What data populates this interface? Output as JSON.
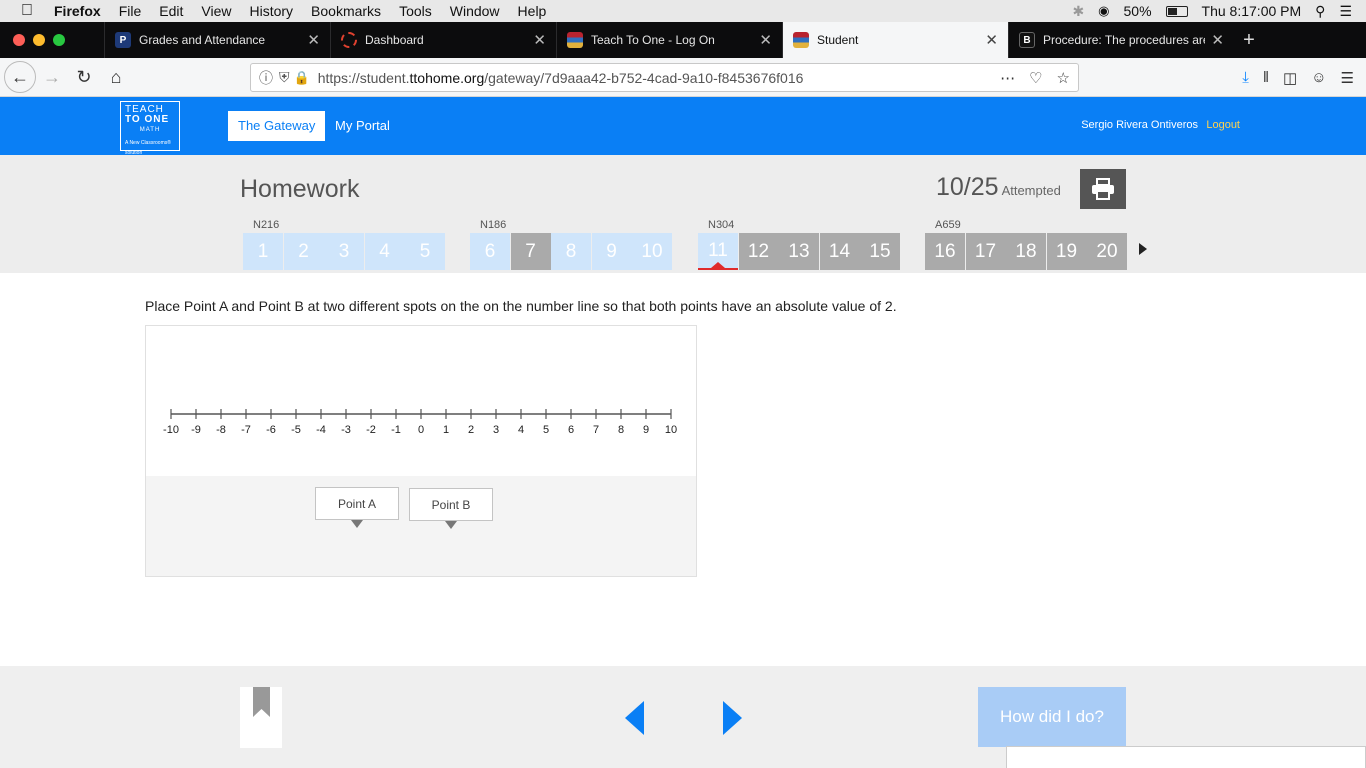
{
  "os_menubar": {
    "app": "Firefox",
    "menus": [
      "File",
      "Edit",
      "View",
      "History",
      "Bookmarks",
      "Tools",
      "Window",
      "Help"
    ],
    "battery": "50%",
    "clock": "Thu 8:17:00 PM"
  },
  "tabs": [
    {
      "label": "Grades and Attendance",
      "favicon": "P",
      "favicon_color": "#1e3a78"
    },
    {
      "label": "Dashboard",
      "favicon": "",
      "favicon_color": "#e0412f"
    },
    {
      "label": "Teach To One - Log On",
      "favicon": "",
      "favicon_color": "#b8232f"
    },
    {
      "label": "Student",
      "favicon": "",
      "favicon_color": "#b8232f",
      "active": true
    },
    {
      "label": "Procedure: The procedures are",
      "favicon": "B",
      "favicon_color": "#111111"
    }
  ],
  "url": {
    "prefix": "https://student.",
    "domain": "ttohome.org",
    "path": "/gateway/7d9aaa42-b752-4cad-9a10-f8453676f016"
  },
  "site": {
    "logo_lines": [
      "TEACH",
      "TO ONE",
      "MATH"
    ],
    "logo_tagline": "A New Classrooms® solution",
    "nav": [
      "The Gateway",
      "My Portal"
    ],
    "user": "Sergio Rivera Ontiveros",
    "logout": "Logout"
  },
  "homework": {
    "title": "Homework",
    "attempted_count": "10/25",
    "attempted_label": "Attempted",
    "groups": [
      {
        "code": "N216",
        "questions": [
          {
            "n": "1",
            "state": "light"
          },
          {
            "n": "2",
            "state": "light"
          },
          {
            "n": "3",
            "state": "light"
          },
          {
            "n": "4",
            "state": "light"
          },
          {
            "n": "5",
            "state": "light"
          }
        ]
      },
      {
        "code": "N186",
        "questions": [
          {
            "n": "6",
            "state": "light"
          },
          {
            "n": "7",
            "state": "dark"
          },
          {
            "n": "8",
            "state": "light"
          },
          {
            "n": "9",
            "state": "light"
          },
          {
            "n": "10",
            "state": "light"
          }
        ]
      },
      {
        "code": "N304",
        "questions": [
          {
            "n": "11",
            "state": "cur"
          },
          {
            "n": "12",
            "state": "dark"
          },
          {
            "n": "13",
            "state": "dark"
          },
          {
            "n": "14",
            "state": "dark"
          },
          {
            "n": "15",
            "state": "dark"
          }
        ]
      },
      {
        "code": "A659",
        "questions": [
          {
            "n": "16",
            "state": "dark"
          },
          {
            "n": "17",
            "state": "dark"
          },
          {
            "n": "18",
            "state": "dark"
          },
          {
            "n": "19",
            "state": "dark"
          },
          {
            "n": "20",
            "state": "dark"
          }
        ]
      }
    ]
  },
  "question": {
    "text": "Place Point A and Point B at two different spots on the on the number line so that both points have an absolute value of 2.",
    "number_line": {
      "min": -10,
      "max": 10,
      "step": 1
    },
    "points": [
      "Point A",
      "Point B"
    ]
  },
  "footer": {
    "how_button": "How did I do?"
  }
}
